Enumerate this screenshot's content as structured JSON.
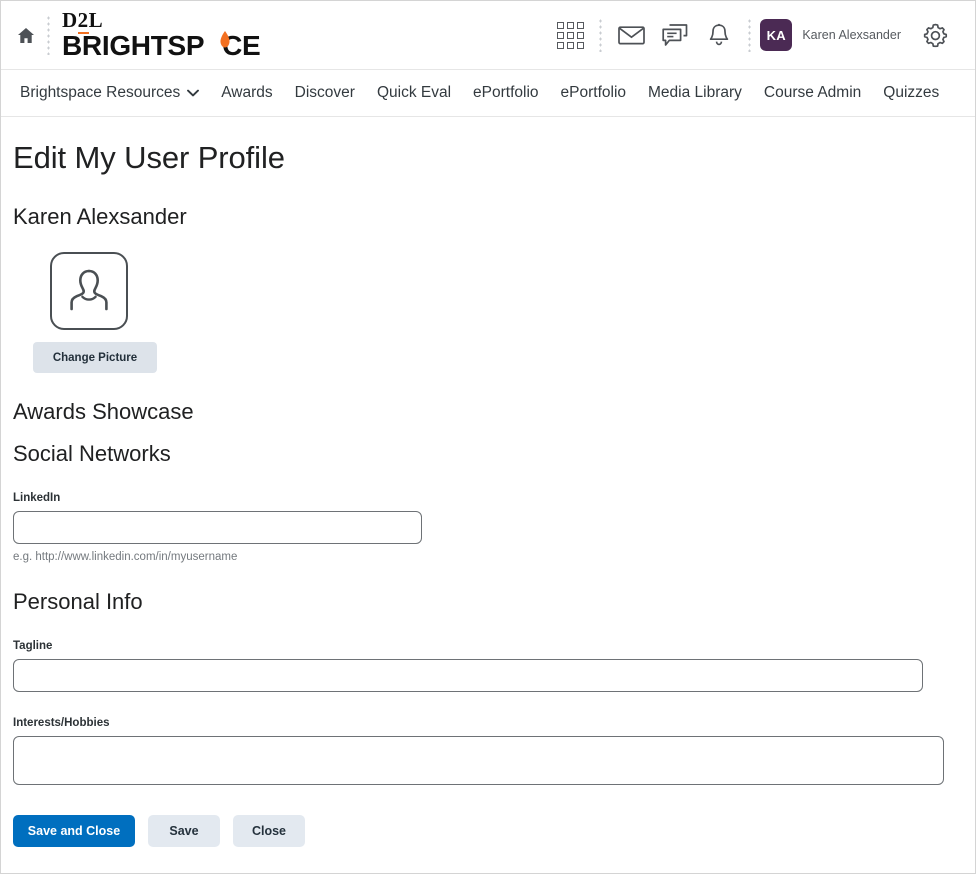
{
  "header": {
    "home_icon": "home-icon",
    "logo": {
      "top": "D2L",
      "bottom_pre": "BRIGHTSP",
      "bottom_post": "CE",
      "accent_color": "#f37021"
    },
    "icons": [
      {
        "name": "waffle-grid-icon",
        "label": "Course Selector"
      },
      {
        "name": "envelope-icon",
        "label": "Email"
      },
      {
        "name": "chat-bubbles-icon",
        "label": "Messages"
      },
      {
        "name": "bell-icon",
        "label": "Notifications"
      }
    ],
    "avatar_initials": "KA",
    "avatar_color": "#4b2a54",
    "username": "Karen Alexsander",
    "settings_icon": "gear-icon"
  },
  "nav": {
    "items": [
      {
        "label": "Brightspace Resources",
        "has_caret": true
      },
      {
        "label": "Awards",
        "has_caret": false
      },
      {
        "label": "Discover",
        "has_caret": false
      },
      {
        "label": "Quick Eval",
        "has_caret": false
      },
      {
        "label": "ePortfolio",
        "has_caret": false
      },
      {
        "label": "ePortfolio",
        "has_caret": false
      },
      {
        "label": "Media Library",
        "has_caret": false
      },
      {
        "label": "Course Admin",
        "has_caret": false
      },
      {
        "label": "Quizzes",
        "has_caret": false
      }
    ]
  },
  "page": {
    "title": "Edit My User Profile",
    "person_name": "Karen Alexsander",
    "change_picture_label": "Change Picture",
    "sections": {
      "awards_showcase": "Awards Showcase",
      "social_networks": "Social Networks",
      "personal_info": "Personal Info"
    },
    "fields": {
      "linkedin": {
        "label": "LinkedIn",
        "value": "",
        "placeholder": "",
        "hint": "e.g. http://www.linkedin.com/in/myusername"
      },
      "tagline": {
        "label": "Tagline",
        "value": "",
        "placeholder": ""
      },
      "interests": {
        "label": "Interests/Hobbies",
        "value": "",
        "placeholder": ""
      }
    },
    "buttons": {
      "save_and_close": "Save and Close",
      "save": "Save",
      "close": "Close",
      "primary_color": "#006fbf",
      "secondary_color": "#e3e9f0"
    }
  }
}
